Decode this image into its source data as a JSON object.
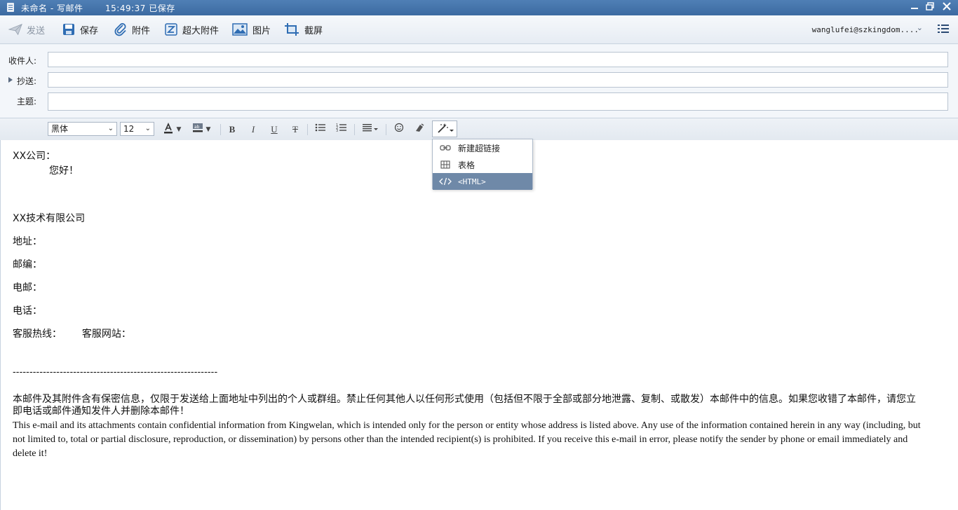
{
  "window": {
    "title": "未命名 - 写邮件",
    "save_status": "15:49:37 已保存"
  },
  "toolbar": {
    "send": "发送",
    "save": "保存",
    "attachment": "附件",
    "large_attachment": "超大附件",
    "image": "图片",
    "screenshot": "截屏",
    "account": "wanglufei@szkingdom...."
  },
  "fields": {
    "to_label": "收件人:",
    "cc_label": "抄送:",
    "subject_label": "主题:",
    "to_value": "",
    "cc_value": "",
    "subject_value": ""
  },
  "format": {
    "font_family": "黑体",
    "font_size": "12"
  },
  "insert_menu": {
    "items": [
      {
        "label": "新建超链接",
        "icon": "link-icon"
      },
      {
        "label": "表格",
        "icon": "table-icon"
      },
      {
        "label": "<HTML>",
        "icon": "code-icon"
      }
    ],
    "highlighted": "<HTML>"
  },
  "body": {
    "greeting_company": "XX公司：",
    "greeting": "您好！",
    "signature_company": "XX技术有限公司",
    "address": "地址：",
    "postcode": "邮编：",
    "email": "电邮：",
    "phone": "电话：",
    "hotline": "客服热线：",
    "website": "客服网站：",
    "separator": "-------------------------------------------------------------",
    "disclaimer_zh": "本邮件及其附件含有保密信息，仅限于发送给上面地址中列出的个人或群组。禁止任何其他人以任何形式使用（包括但不限于全部或部分地泄露、复制、或散发）本邮件中的信息。如果您收错了本邮件，请您立即电话或邮件通知发件人并删除本邮件！",
    "disclaimer_en": "This e-mail and its attachments contain confidential information from Kingwelan, which is intended only for the person or entity whose address is listed above. Any use of the information contained herein in any way (including, but not limited to, total or partial disclosure, reproduction, or dissemination) by persons other than the intended recipient(s) is prohibited. If you receive this e-mail in error, please notify the sender by phone or email immediately and delete it!"
  },
  "colors": {
    "titlebar": "#4573a9",
    "menu_highlight": "#6f89a8"
  }
}
